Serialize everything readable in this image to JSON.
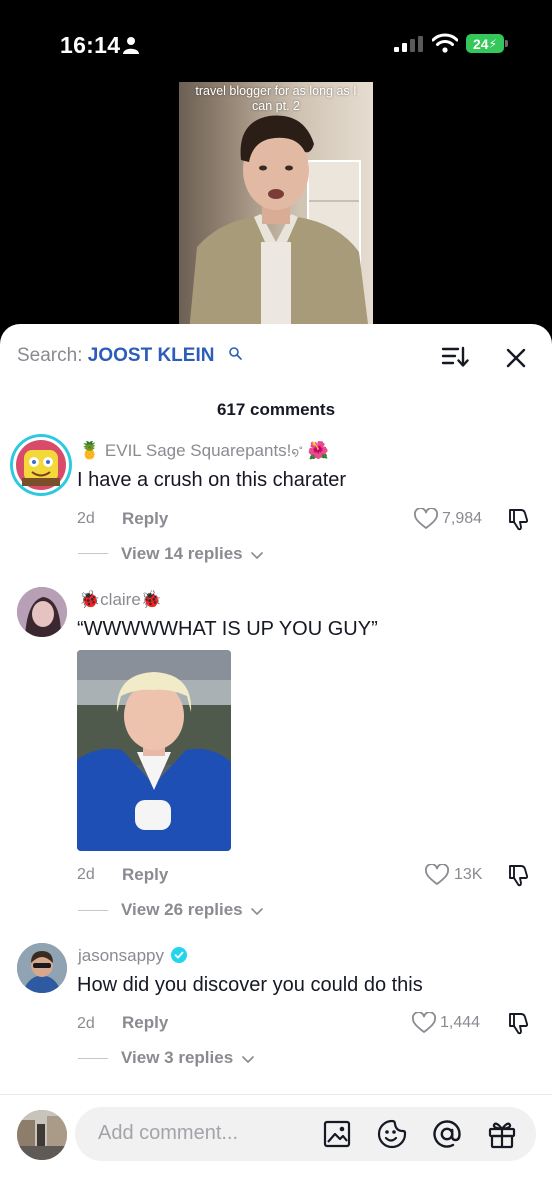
{
  "status_bar": {
    "time": "16:14",
    "battery": "24"
  },
  "video": {
    "caption_line1": "travel blogger for as long as I",
    "caption_line2": "can pt. 2"
  },
  "search": {
    "prefix": "Search:",
    "term": "JOOST KLEIN"
  },
  "comments_count": "617 comments",
  "comments": [
    {
      "username": "EVIL Sage Squarepants!",
      "prefix_emoji": "🍍",
      "suffix_emoji": "🌺",
      "text": "I have a crush on this charater",
      "date": "2d",
      "reply_label": "Reply",
      "likes": "7,984",
      "view_replies": "View 14 replies"
    },
    {
      "username": "claire",
      "prefix_emoji": "🐞",
      "suffix_emoji": "🐞",
      "text": "“WWWWWHAT IS UP YOU GUY”",
      "date": "2d",
      "reply_label": "Reply",
      "likes": "13K",
      "view_replies": "View 26 replies"
    },
    {
      "username": "jasonsappy",
      "verified": true,
      "text": "How did you discover you could do this",
      "date": "2d",
      "reply_label": "Reply",
      "likes": "1,444",
      "view_replies": "View 3 replies"
    }
  ],
  "composer": {
    "placeholder": "Add comment..."
  },
  "colors": {
    "search_term": "#2b5db9",
    "verified": "#20d5ec",
    "battery": "#34c759",
    "muted_text": "#8a8b91"
  },
  "icons": [
    "person-icon",
    "signal-icon",
    "wifi-icon",
    "search-glyph-icon",
    "sort-icon",
    "close-icon",
    "heart-icon",
    "dislike-icon",
    "chevron-down-icon",
    "verified-icon",
    "image-icon",
    "emoji-icon",
    "mention-icon",
    "gift-icon"
  ]
}
